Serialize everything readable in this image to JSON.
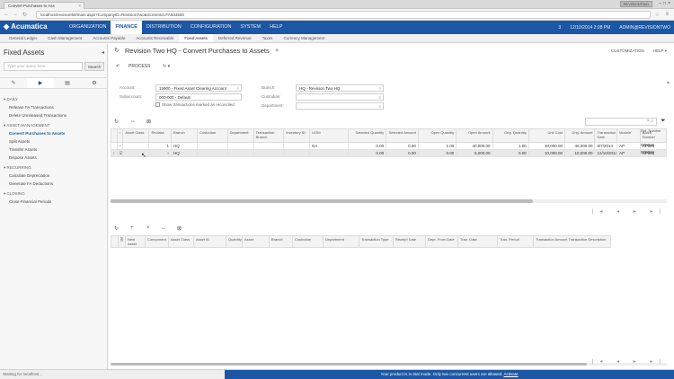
{
  "browser": {
    "tab_title": "Convert Purchases to Ass",
    "user_badge": "REVISIONTWO",
    "url": "localhost/revision50/main.aspx?CompanyID=RevisionTwo&ScreenId=FA504500"
  },
  "topbar": {
    "logo": "Acumatica",
    "nav": [
      "ORGANIZATION",
      "FINANCE",
      "DISTRIBUTION",
      "CONFIGURATION",
      "SYSTEM",
      "HELP"
    ],
    "active_nav": "FINANCE",
    "count": "3",
    "datetime": "12/10/2014 2:08 PM",
    "user": "ADMIN@REVISIONTWO"
  },
  "subbar": {
    "items": [
      "General Ledger",
      "Cash Management",
      "Accounts Payable",
      "Accounts Receivable",
      "Fixed Assets",
      "Deferred Revenue",
      "Taxes",
      "Currency Management"
    ],
    "active": "Fixed Assets"
  },
  "left_panel": {
    "title": "Fixed Assets",
    "search_placeholder": "Type your query here",
    "search_button": "Search",
    "tree": [
      {
        "header": "DAILY",
        "items": [
          "Release FA Transactions",
          "Delete Unreleased Transactions"
        ]
      },
      {
        "header": "ASSET MANAGEMENT",
        "items": [
          "Convert Purchases to Assets",
          "Split Assets",
          "Transfer Assets",
          "Dispose Assets"
        ]
      },
      {
        "header": "RECURRING",
        "items": [
          "Calculate Depreciation",
          "Generate FA Deductions"
        ]
      },
      {
        "header": "CLOSING",
        "items": [
          "Close Financial Periods"
        ]
      }
    ],
    "selected_item": "Convert Purchases to Assets"
  },
  "page": {
    "title": "Revision Two HQ - Convert Purchases to Assets",
    "customization": "CUSTOMIZATION",
    "help": "HELP",
    "toolbar_process": "PROCESS",
    "form": {
      "account_label": "Account:",
      "account_value": "15900 - Fixed Asset Clearing Account",
      "subaccount_label": "Subaccount:",
      "subaccount_value": "000-000 - Default",
      "show_checkbox_label": "Show transactions marked as reconciled",
      "branch_label": "Branch:",
      "branch_value": "HQ - Revision Two HQ",
      "custodian_label": "Custodian:",
      "custodian_value": "",
      "department_label": "Department:",
      "department_value": ""
    }
  },
  "grid1": {
    "columns": [
      "Asset Class",
      "Reclass",
      "Branch",
      "Custodian",
      "Department",
      "Transaction Branch",
      "Inventory ID",
      "UOM",
      "Selected Quantity",
      "Selected Amount",
      "Open Quantity",
      "Open Amount",
      "Orig. Quantity",
      "Unit Cost",
      "Orig. Amount",
      "Transaction Date",
      "Module",
      "Batch Number",
      "Ref. Number"
    ],
    "rows": [
      [
        "",
        "1",
        "HQ",
        "",
        "",
        "",
        "",
        "EA",
        "0.00",
        "0.00",
        "1.00",
        "40,000.00",
        "1.00",
        "40,000.00",
        "40,000.00",
        "6/7/2014",
        "AP",
        "AP001",
        "000016"
      ],
      [
        "",
        "",
        "HQ",
        "",
        "",
        "",
        "",
        "",
        "0.00",
        "0.00",
        "0.00",
        "5,000.00",
        "0.00",
        "10,000.00",
        "10,000.00",
        "12/10/2014",
        "AP",
        "AP001",
        "000016"
      ]
    ]
  },
  "grid2": {
    "columns": [
      "New Asset",
      "Component",
      "Asset Class",
      "Asset ID",
      "Quantity",
      "Asset",
      "Branch",
      "Custodian",
      "Department",
      "Transaction Type",
      "Receipt Date",
      "Depr. From Date",
      "Tran. Date",
      "Tran. Period",
      "Transaction Amount",
      "Transaction Description"
    ]
  },
  "status": {
    "left": "Waiting for localhost...",
    "trial_text": "Your product is in trial mode. Only two concurrent users are allowed.",
    "trial_link": "Activate"
  }
}
